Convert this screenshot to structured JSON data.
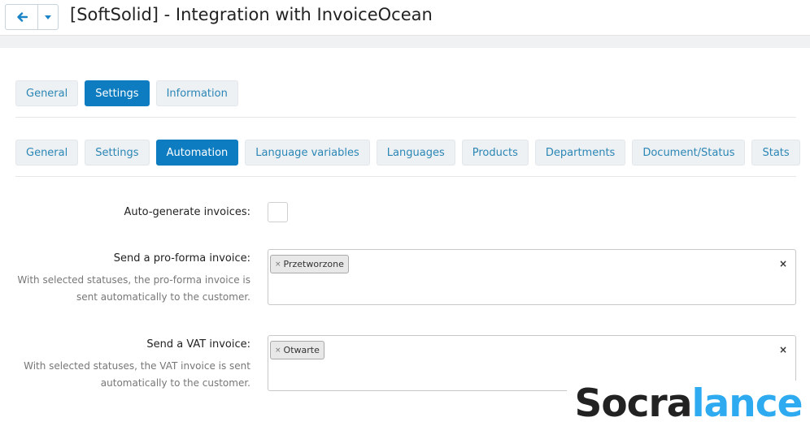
{
  "header": {
    "title": "[SoftSolid] - Integration with InvoiceOcean",
    "back_icon": "arrow-left-icon",
    "caret_icon": "caret-down-icon",
    "accent": "#0e7cc0"
  },
  "top_tabs": [
    {
      "label": "General",
      "active": false
    },
    {
      "label": "Settings",
      "active": true
    },
    {
      "label": "Information",
      "active": false
    }
  ],
  "sub_tabs": [
    {
      "label": "General",
      "active": false
    },
    {
      "label": "Settings",
      "active": false
    },
    {
      "label": "Automation",
      "active": true
    },
    {
      "label": "Language variables",
      "active": false
    },
    {
      "label": "Languages",
      "active": false
    },
    {
      "label": "Products",
      "active": false
    },
    {
      "label": "Departments",
      "active": false
    },
    {
      "label": "Document/Status",
      "active": false
    },
    {
      "label": "Stats",
      "active": false
    }
  ],
  "form": {
    "auto_generate": {
      "label": "Auto-generate invoices:",
      "checked": false
    },
    "proforma": {
      "label": "Send a pro-forma invoice:",
      "hint_line1": "With selected statuses, the pro-forma invoice is",
      "hint_line2": "sent automatically to the customer.",
      "selected": "Przetworzone",
      "chip_remove": "×",
      "clear": "×"
    },
    "vat": {
      "label": "Send a VAT invoice:",
      "hint_line1": "With selected statuses, the VAT invoice is sent",
      "hint_line2": "automatically to the customer.",
      "selected": "Otwarte",
      "chip_remove": "×",
      "clear": "×"
    }
  },
  "watermark": {
    "part1": "Socra",
    "part2": "lance"
  }
}
